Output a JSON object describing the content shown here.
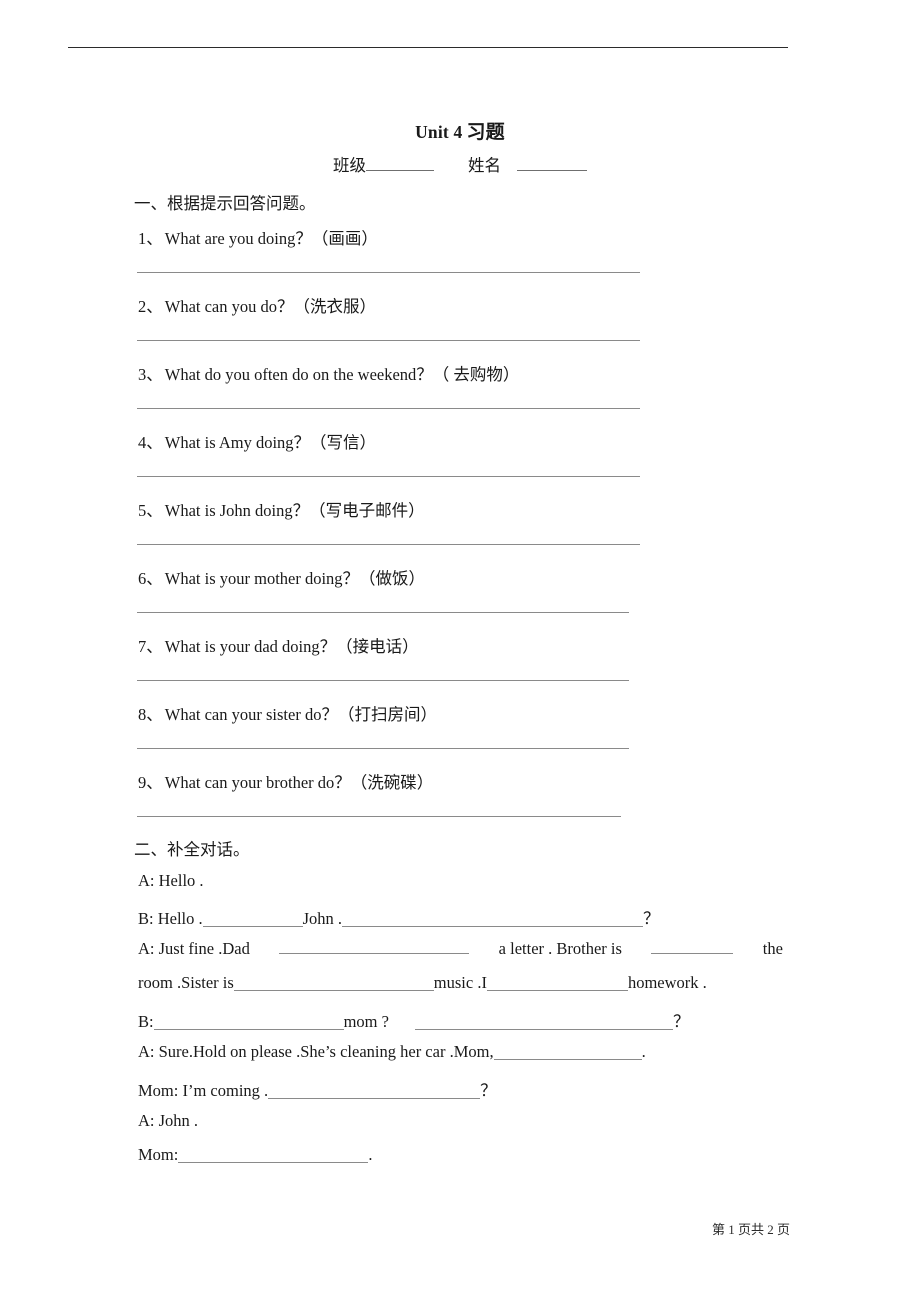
{
  "document": {
    "title_en": "Unit 4",
    "title_cn": "习题",
    "field_class_label": "班级",
    "field_name_label": "姓名",
    "footer": "第 1 页共 2 页"
  },
  "section_one": {
    "heading": "一、根据提示回答问题。",
    "questions": [
      {
        "num": "1、",
        "text": "What are you doing？（画画）"
      },
      {
        "num": "2、",
        "text": "What can you do？（洗衣服）"
      },
      {
        "num": "3、",
        "text": "What do you often do on the weekend？（ 去购物）"
      },
      {
        "num": "4、",
        "text": "What is Amy doing？（写信）"
      },
      {
        "num": "5、",
        "text": "What is John doing？（写电子邮件）"
      },
      {
        "num": "6、",
        "text": "What is your mother doing？（做饭）"
      },
      {
        "num": "7、",
        "text": "What is your dad doing？（接电话）"
      },
      {
        "num": "8、",
        "text": "What can your sister do？（打扫房间）"
      },
      {
        "num": "9、",
        "text": "What can your brother do？（洗碗碟）"
      }
    ]
  },
  "section_two": {
    "heading": "二、补全对话。",
    "lines": {
      "l1": "A: Hello .",
      "l2_a": "B: Hello .",
      "l2_b": "John .",
      "l2_c": "？",
      "l3_a": "A:  Just   fine  .Dad",
      "l3_b": "a  letter  .  Brother  is",
      "l3_c": "the",
      "l4_a": "room .Sister is",
      "l4_b": "music .I",
      "l4_c": "homework .",
      "l5_a": "B:",
      "l5_b": "mom ?",
      "l5_c": "？",
      "l6_a": "A: Sure.Hold on please .She’s cleaning her car .Mom,",
      "l6_b": ".",
      "l7_a": "Mom: I’m coming .",
      "l7_b": "？",
      "l8": "A: John .",
      "l9_a": "Mom:",
      "l9_b": "."
    }
  }
}
